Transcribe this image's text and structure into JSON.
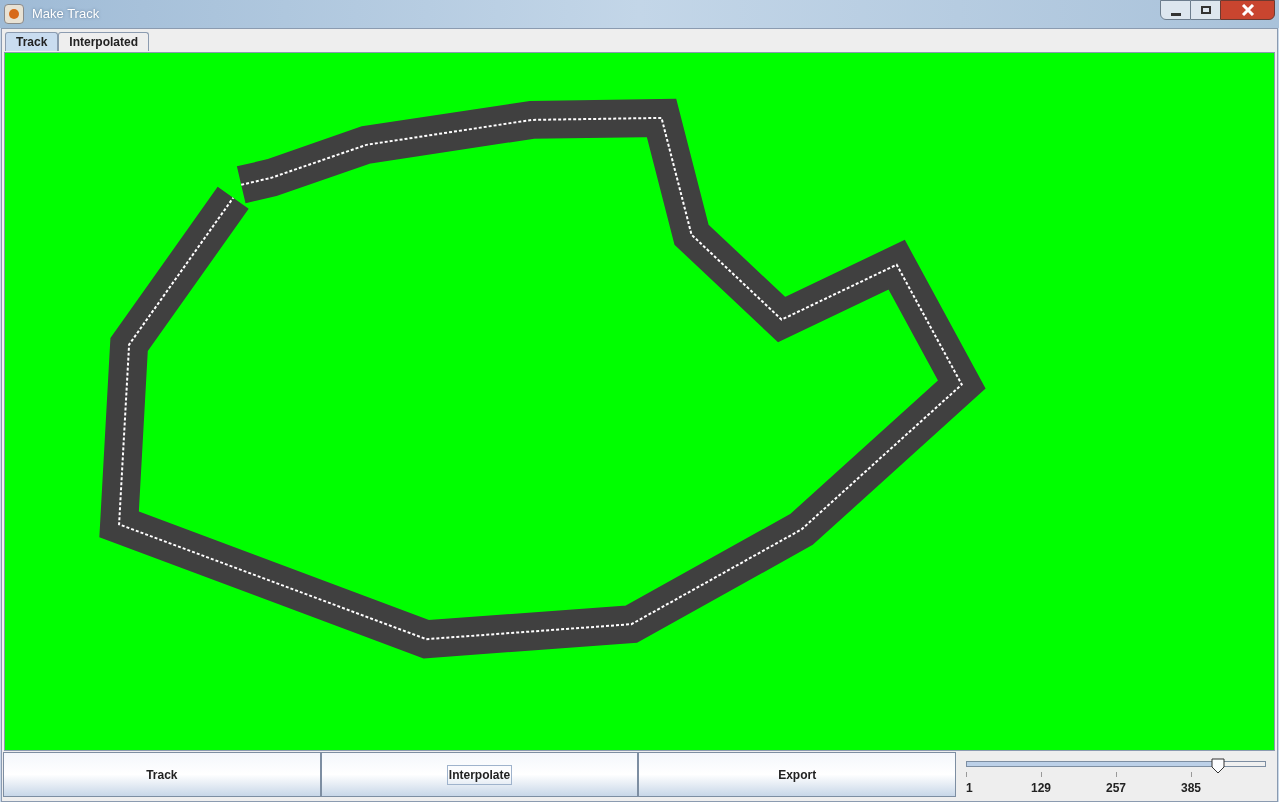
{
  "window": {
    "title": "Make Track"
  },
  "tabs": [
    {
      "label": "Track",
      "selected": true
    },
    {
      "label": "Interpolated",
      "selected": false
    }
  ],
  "buttons": [
    {
      "label": "Track",
      "focused": false
    },
    {
      "label": "Interpolate",
      "focused": true
    },
    {
      "label": "Export",
      "focused": false
    }
  ],
  "slider": {
    "level": 0.84,
    "tick_labels": [
      "1",
      "129",
      "257",
      "385"
    ]
  }
}
